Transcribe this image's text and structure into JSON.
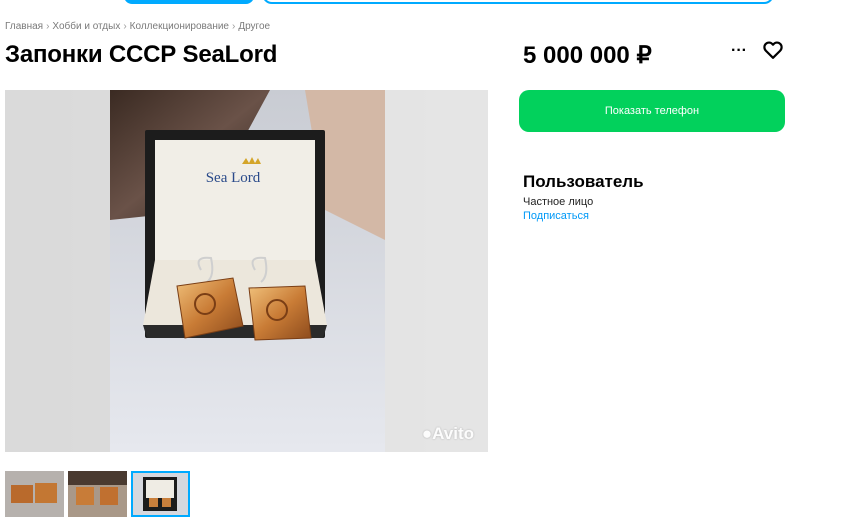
{
  "breadcrumb": {
    "items": [
      "Главная",
      "Хобби и отдых",
      "Коллекционирование",
      "Другое"
    ],
    "separator": "›"
  },
  "listing": {
    "title": "Запонки СССР SeaLord",
    "price": "5 000 000 ₽"
  },
  "actions": {
    "more_icon": "more-dots-icon",
    "favorite_icon": "heart-icon",
    "show_phone_label": "Показать телефон"
  },
  "gallery": {
    "photo_subject": "cufflinks-in-box",
    "brand_on_box": "Sea Lord",
    "watermark": "Avito",
    "thumbnail_count": 3,
    "active_thumbnail_index": 2
  },
  "seller": {
    "name": "Пользователь",
    "type": "Частное лицо",
    "subscribe_label": "Подписаться"
  },
  "colors": {
    "primary_action": "#02d15c",
    "link": "#0099f7",
    "accent": "#00aaff"
  }
}
